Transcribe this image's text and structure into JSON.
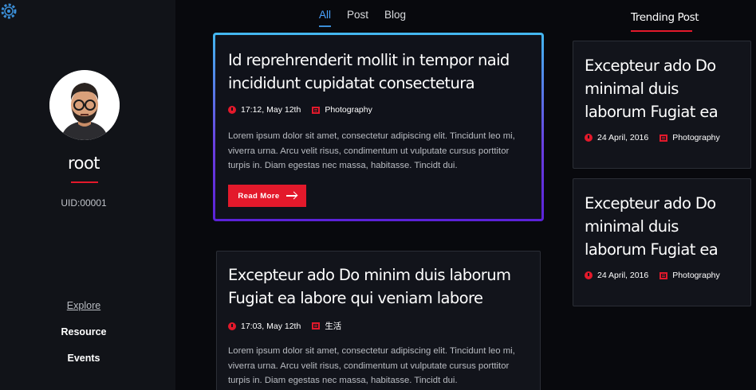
{
  "logo": {
    "icon": "gear-logo-icon",
    "color": "#3b8ed6"
  },
  "sidebar": {
    "username": "root",
    "uid": "UID:00001",
    "nav": [
      {
        "label": "Explore",
        "active": true
      },
      {
        "label": "Resource"
      },
      {
        "label": "Events"
      }
    ]
  },
  "tabs": [
    {
      "label": "All",
      "active": true
    },
    {
      "label": "Post"
    },
    {
      "label": "Blog"
    }
  ],
  "posts": [
    {
      "title": "Id reprehrenderit mollit in tempor naid incididunt cupidatat consectetura",
      "time": "17:12, May 12th",
      "category": "Photography",
      "excerpt": "Lorem ipsum dolor sit amet, consectetur adipiscing elit. Tincidunt leo mi, viverra urna. Arcu velit risus, condimentum ut vulputate cursus porttitor turpis in. Diam egestas nec massa, habitasse. Tincidt dui.",
      "read_more": "Read More"
    },
    {
      "title": "Excepteur ado Do minim duis laborum Fugiat ea labore qui veniam labore",
      "time": "17:03, May 12th",
      "category": "生活",
      "excerpt": "Lorem ipsum dolor sit amet, consectetur adipiscing elit. Tincidunt leo mi, viverra urna. Arcu velit risus, condimentum ut vulputate cursus porttitor turpis in. Diam egestas nec massa, habitasse. Tincidt dui."
    }
  ],
  "trending": {
    "heading": "Trending Post",
    "items": [
      {
        "title": "Excepteur ado Do minimal duis laborum Fugiat ea",
        "date": "24 April, 2016",
        "category": "Photography"
      },
      {
        "title": "Excepteur ado Do minimal duis laborum Fugiat ea",
        "date": "24 April, 2016",
        "category": "Photography"
      }
    ]
  },
  "colors": {
    "accent": "#e3192b",
    "tab_active": "#4aa3ff",
    "background": "#08090d",
    "sidebar": "#111318"
  }
}
